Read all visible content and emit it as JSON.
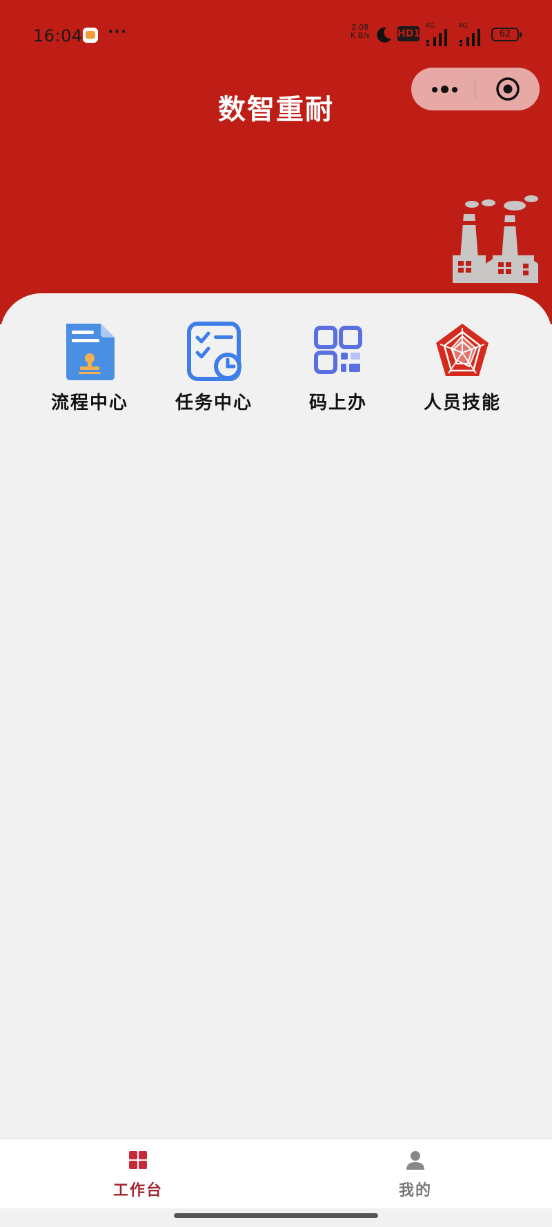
{
  "status_bar": {
    "time": "16:04",
    "network_speed_value": "2.08",
    "network_speed_unit": "K B/s",
    "hd_badge": "HD1",
    "signal1_label": "4G",
    "signal2_label": "4G",
    "battery_level": "62"
  },
  "header": {
    "title": "数智重耐"
  },
  "colors": {
    "brand_red": "#be1e16",
    "tab_active": "#a32430",
    "tab_inactive": "#777777"
  },
  "grid": {
    "items": [
      {
        "label": "流程中心",
        "icon": "document-stamp-icon"
      },
      {
        "label": "任务中心",
        "icon": "checklist-clock-icon"
      },
      {
        "label": "码上办",
        "icon": "qr-code-icon"
      },
      {
        "label": "人员技能",
        "icon": "radar-chart-icon"
      }
    ]
  },
  "tabbar": {
    "tabs": [
      {
        "label": "工作台",
        "icon": "grid-icon",
        "active": true
      },
      {
        "label": "我的",
        "icon": "user-icon",
        "active": false
      }
    ]
  }
}
